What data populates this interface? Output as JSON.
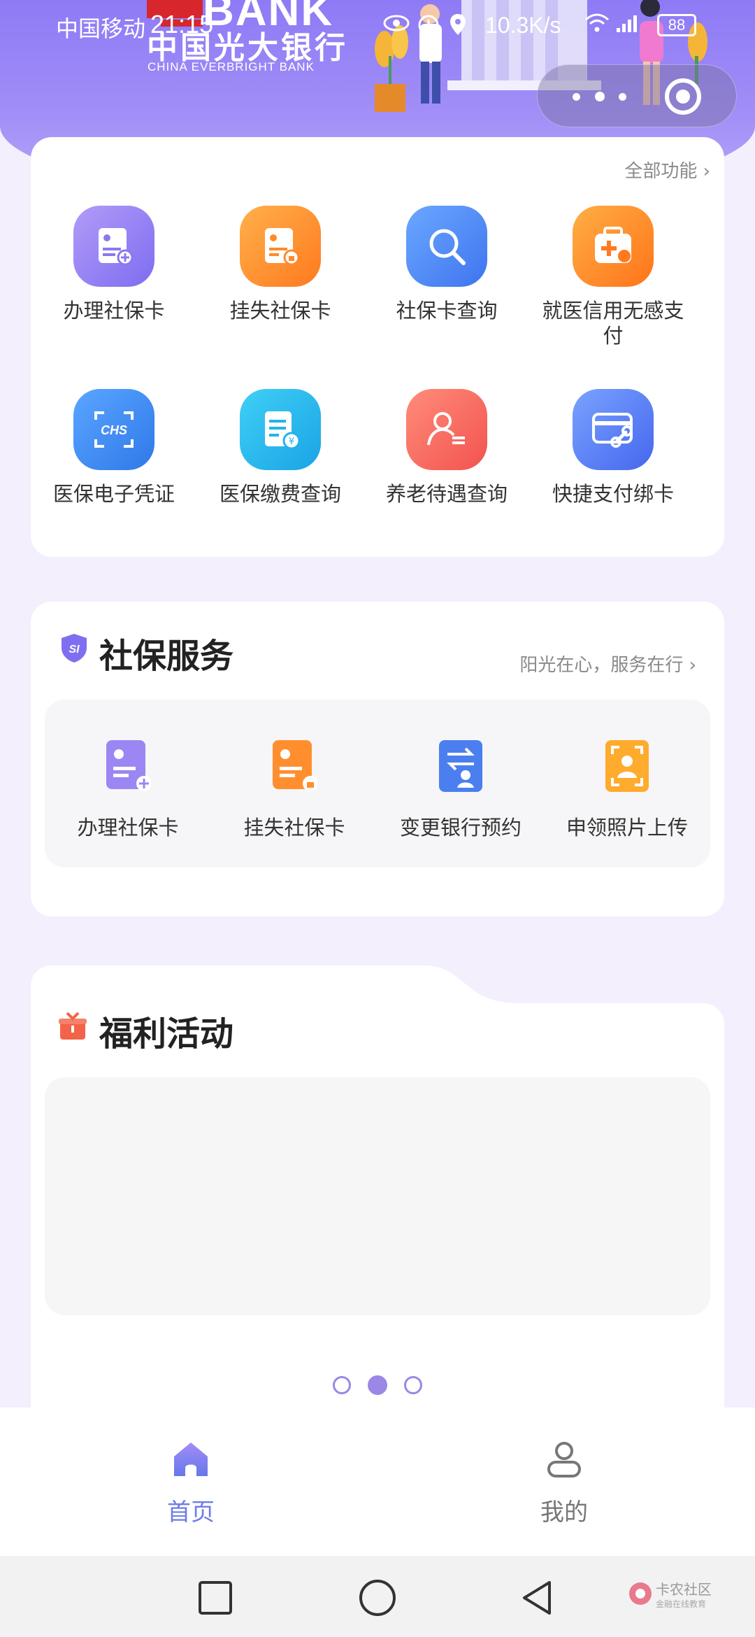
{
  "status_bar": {
    "carrier": "中国移动",
    "time": "21:15",
    "net_speed": "10.3K/s",
    "battery": "88"
  },
  "banner": {
    "bank_name_cn": "中国光大银行",
    "bank_name_en": "CHINA EVERBRIGHT BANK",
    "bank_logo_en": "BANK"
  },
  "top_card": {
    "all_functions": "全部功能",
    "items": [
      {
        "label": "办理社保卡",
        "icon": "add-card-icon",
        "color": "#8b78ef"
      },
      {
        "label": "挂失社保卡",
        "icon": "lost-card-icon",
        "color": "#ff8a2b"
      },
      {
        "label": "社保卡查询",
        "icon": "search-icon",
        "color": "#4f8df5"
      },
      {
        "label": "就医信用无感支付",
        "icon": "medical-kit-icon",
        "color": "#ff8a2b"
      },
      {
        "label": "医保电子凭证",
        "icon": "chs-scan-icon",
        "color": "#3f8ff0"
      },
      {
        "label": "医保缴费查询",
        "icon": "payment-doc-icon",
        "color": "#1fb4ea"
      },
      {
        "label": "养老待遇查询",
        "icon": "pension-user-icon",
        "color": "#f56a66"
      },
      {
        "label": "快捷支付绑卡",
        "icon": "card-link-icon",
        "color": "#5b7ff2"
      }
    ]
  },
  "service": {
    "title": "社保服务",
    "badge": "SI",
    "slogan": "阳光在心，服务在行",
    "items": [
      {
        "label": "办理社保卡",
        "icon": "add-card-icon"
      },
      {
        "label": "挂失社保卡",
        "icon": "lost-card-icon"
      },
      {
        "label": "变更银行预约",
        "icon": "swap-user-icon"
      },
      {
        "label": "申领照片上传",
        "icon": "photo-frame-icon"
      }
    ]
  },
  "welfare": {
    "title": "福利活动",
    "carousel_active_index": 1,
    "carousel_count": 3
  },
  "tabbar": {
    "home": "首页",
    "mine": "我的"
  },
  "watermark": {
    "line1": "卡农社区",
    "line2": "金融在线教育"
  }
}
